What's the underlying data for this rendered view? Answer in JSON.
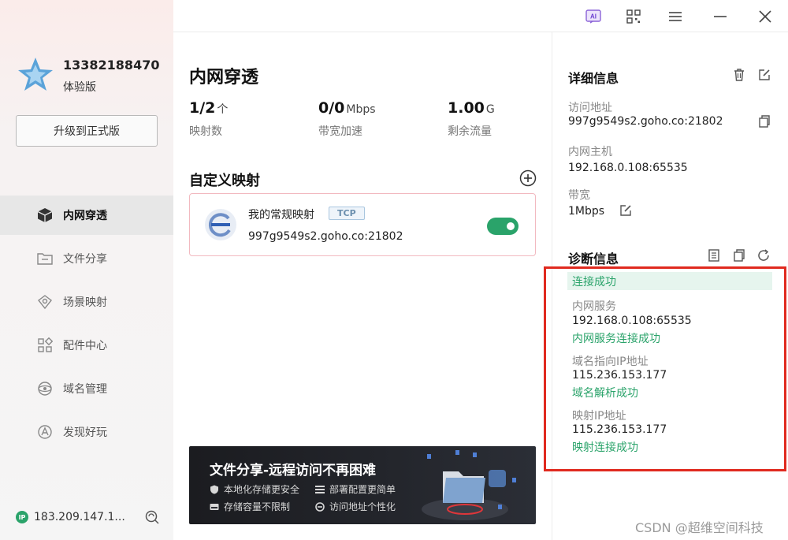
{
  "user": {
    "phone": "13382188470",
    "plan": "体验版",
    "upgrade_label": "升级到正式版"
  },
  "nav": [
    {
      "label": "内网穿透",
      "icon": "cube-icon",
      "active": true
    },
    {
      "label": "文件分享",
      "icon": "folder-share-icon"
    },
    {
      "label": "场景映射",
      "icon": "scene-map-icon"
    },
    {
      "label": "配件中心",
      "icon": "apps-grid-icon"
    },
    {
      "label": "域名管理",
      "icon": "domain-icon"
    },
    {
      "label": "发现好玩",
      "icon": "discover-icon"
    }
  ],
  "footer": {
    "ip_badge": "IP",
    "ip": "183.209.147.1..."
  },
  "titlebar": {
    "ai_label": "AI"
  },
  "main": {
    "title": "内网穿透",
    "stats": [
      {
        "value": "1/2",
        "unit": "个",
        "label": "映射数"
      },
      {
        "value": "0/0",
        "unit": "Mbps",
        "label": "带宽加速"
      },
      {
        "value": "1.00",
        "unit": "G",
        "label": "剩余流量"
      }
    ],
    "section_title": "自定义映射",
    "mapping": {
      "name": "我的常规映射",
      "protocol": "TCP",
      "address": "997g9549s2.goho.co:21802",
      "enabled": true
    },
    "banner": {
      "title": "文件分享-远程访问不再困难",
      "features": [
        "本地化存储更安全",
        "部署配置更简单",
        "存储容量不限制",
        "访问地址个性化"
      ]
    }
  },
  "details": {
    "title": "详细信息",
    "access_label": "访问地址",
    "access_value": "997g9549s2.goho.co:21802",
    "host_label": "内网主机",
    "host_value": "192.168.0.108:65535",
    "bandwidth_label": "带宽",
    "bandwidth_value": "1Mbps"
  },
  "diagnosis": {
    "title": "诊断信息",
    "status": "连接成功",
    "items": [
      {
        "label": "内网服务",
        "value": "192.168.0.108:65535",
        "result": "内网服务连接成功"
      },
      {
        "label": "域名指向IP地址",
        "value": "115.236.153.177",
        "result": "域名解析成功"
      },
      {
        "label": "映射IP地址",
        "value": "115.236.153.177",
        "result": "映射连接成功"
      }
    ]
  },
  "watermark": "CSDN @超维空间科技",
  "colors": {
    "accent_green": "#2aa36a",
    "highlight_red": "#e02a1f",
    "card_border": "#f2b9c0"
  }
}
